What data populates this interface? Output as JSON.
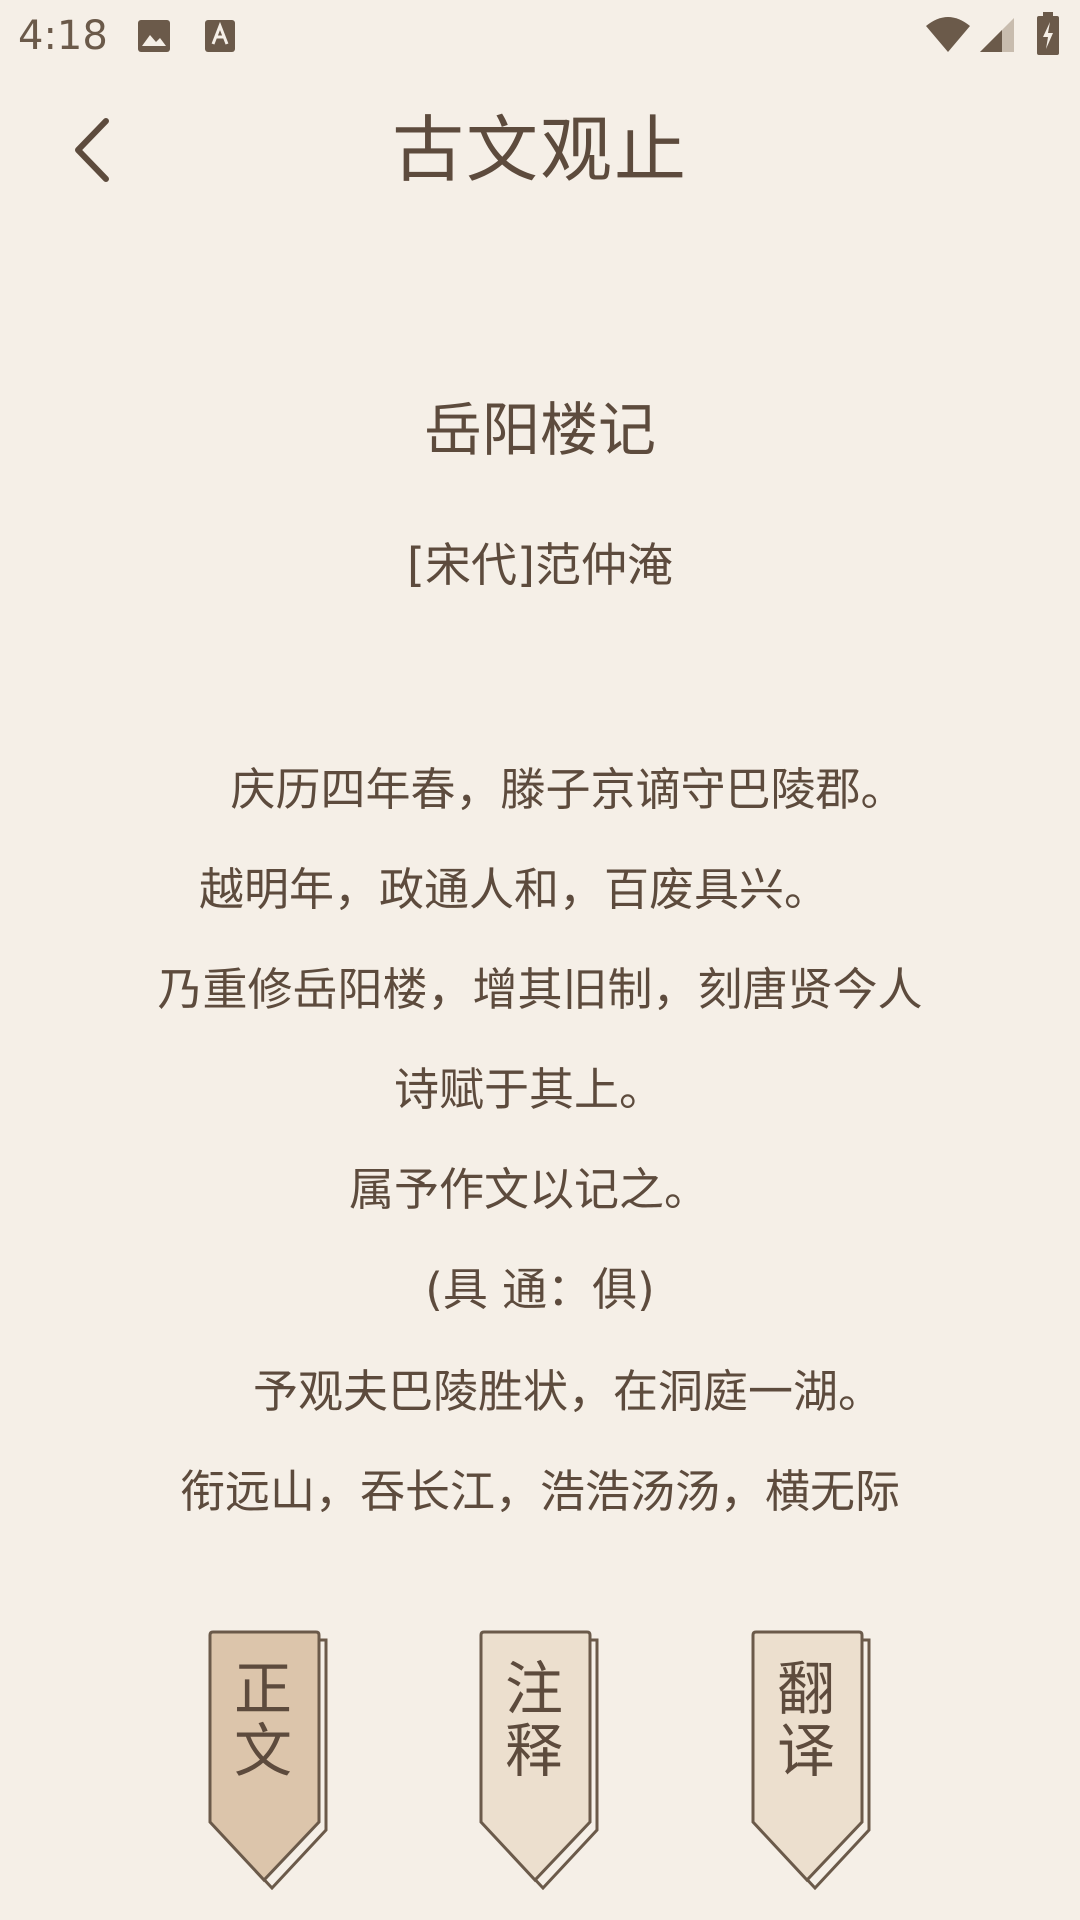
{
  "status_bar": {
    "time": "4:18",
    "icons_left": [
      "image-icon",
      "font-a-icon"
    ],
    "icons_right": [
      "wifi-icon",
      "signal-icon",
      "battery-charging-icon"
    ]
  },
  "header": {
    "title": "古文观止",
    "back_icon": "chevron-left-icon"
  },
  "content": {
    "title": "岳阳楼记",
    "author": "[宋代]范仲淹",
    "lines": [
      "庆历四年春，滕子京谪守巴陵郡。",
      "越明年，政通人和，百废具兴。",
      "乃重修岳阳楼，增其旧制，刻唐贤今人",
      "诗赋于其上。",
      "属予作文以记之。",
      "(具 通：俱)",
      "予观夫巴陵胜状，在洞庭一湖。",
      "衔远山，吞长江，浩浩汤汤，横无际"
    ]
  },
  "tabs": [
    {
      "label_1": "正",
      "label_2": "文",
      "active": true
    },
    {
      "label_1": "注",
      "label_2": "释",
      "active": false
    },
    {
      "label_1": "翻",
      "label_2": "译",
      "active": false
    }
  ],
  "colors": {
    "background": "#f5efe7",
    "text": "#5d4b3d",
    "tab_active": "#dcc5ab",
    "tab_inactive": "#ecdfce",
    "tab_border": "#6b5a4a"
  }
}
